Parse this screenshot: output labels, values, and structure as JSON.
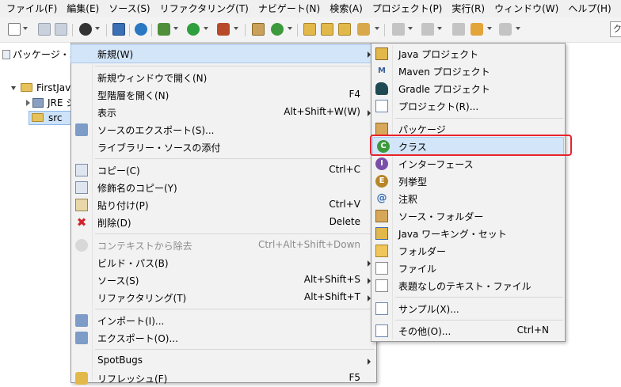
{
  "menubar": {
    "items": [
      "ファイル(F)",
      "編集(E)",
      "ソース(S)",
      "リファクタリング(T)",
      "ナビゲート(N)",
      "検索(A)",
      "プロジェクト(P)",
      "実行(R)",
      "ウィンドウ(W)",
      "ヘルプ(H)"
    ]
  },
  "search": {
    "text": "ク"
  },
  "view_tab": {
    "label": "パッケージ・エ"
  },
  "tree": {
    "project": "FirstJav",
    "jre": "JRE シ",
    "src": "src"
  },
  "context_menu": {
    "items": [
      {
        "label": "新規(W)",
        "shortcut": "",
        "submenu": true
      },
      {
        "label": "新規ウィンドウで開く(N)",
        "shortcut": ""
      },
      {
        "label": "型階層を開く(N)",
        "shortcut": "F4"
      },
      {
        "label": "表示",
        "shortcut": "Alt+Shift+W(W)",
        "submenu": true
      },
      {
        "label": "ソースのエクスポート(S)...",
        "shortcut": ""
      },
      {
        "label": "ライブラリー・ソースの添付",
        "shortcut": ""
      },
      {
        "label": "コピー(C)",
        "shortcut": "Ctrl+C"
      },
      {
        "label": "修飾名のコピー(Y)",
        "shortcut": ""
      },
      {
        "label": "貼り付け(P)",
        "shortcut": "Ctrl+V"
      },
      {
        "label": "削除(D)",
        "shortcut": "Delete"
      },
      {
        "label": "コンテキストから除去",
        "shortcut": "Ctrl+Alt+Shift+Down",
        "disabled": true
      },
      {
        "label": "ビルド・パス(B)",
        "shortcut": "",
        "submenu": true
      },
      {
        "label": "ソース(S)",
        "shortcut": "Alt+Shift+S",
        "submenu": true
      },
      {
        "label": "リファクタリング(T)",
        "shortcut": "Alt+Shift+T",
        "submenu": true
      },
      {
        "label": "インポート(I)...",
        "shortcut": ""
      },
      {
        "label": "エクスポート(O)...",
        "shortcut": ""
      },
      {
        "label": "SpotBugs",
        "shortcut": "",
        "submenu": true
      },
      {
        "label": "リフレッシュ(F)",
        "shortcut": "F5"
      }
    ]
  },
  "new_submenu": {
    "items": [
      {
        "label": "Java プロジェクト",
        "shortcut": "",
        "icon": "java-project-icon"
      },
      {
        "label": "Maven プロジェクト",
        "shortcut": "",
        "icon": "maven-project-icon"
      },
      {
        "label": "Gradle プロジェクト",
        "shortcut": "",
        "icon": "gradle-project-icon"
      },
      {
        "label": "プロジェクト(R)...",
        "shortcut": "",
        "icon": "project-icon"
      },
      {
        "label": "パッケージ",
        "shortcut": "",
        "icon": "package-icon"
      },
      {
        "label": "クラス",
        "shortcut": "",
        "icon": "class-icon"
      },
      {
        "label": "インターフェース",
        "shortcut": "",
        "icon": "interface-icon"
      },
      {
        "label": "列挙型",
        "shortcut": "",
        "icon": "enum-icon"
      },
      {
        "label": "注釈",
        "shortcut": "",
        "icon": "annotation-icon"
      },
      {
        "label": "ソース・フォルダー",
        "shortcut": "",
        "icon": "source-folder-icon"
      },
      {
        "label": "Java ワーキング・セット",
        "shortcut": "",
        "icon": "working-set-icon"
      },
      {
        "label": "フォルダー",
        "shortcut": "",
        "icon": "folder-icon"
      },
      {
        "label": "ファイル",
        "shortcut": "",
        "icon": "file-icon"
      },
      {
        "label": "表題なしのテキスト・ファイル",
        "shortcut": "",
        "icon": "untitled-text-file-icon"
      },
      {
        "label": "サンプル(X)...",
        "shortcut": "",
        "icon": "sample-icon"
      },
      {
        "label": "その他(O)...",
        "shortcut": "Ctrl+N",
        "icon": "other-icon"
      }
    ]
  },
  "colors": {
    "highlight": "#d3e5f8",
    "callout_border": "#e8232b",
    "menu_bg": "#f2f2f2"
  }
}
